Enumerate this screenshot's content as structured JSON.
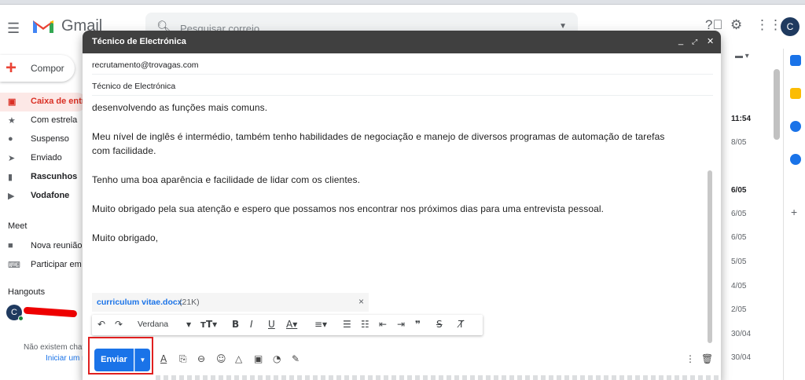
{
  "app": {
    "name": "Gmail"
  },
  "search": {
    "placeholder": "Pesquisar correio"
  },
  "account": {
    "initial": "C"
  },
  "sidebar": {
    "compose_label": "Compor",
    "items": [
      {
        "label": "Caixa de entr",
        "icon": "inbox-icon",
        "active": true
      },
      {
        "label": "Com estrela",
        "icon": "star-icon"
      },
      {
        "label": "Suspenso",
        "icon": "clock-icon"
      },
      {
        "label": "Enviado",
        "icon": "send-icon"
      },
      {
        "label": "Rascunhos",
        "icon": "draft-icon",
        "bold": true
      },
      {
        "label": "Vodafone",
        "icon": "label-icon",
        "bold": true
      }
    ],
    "meet": {
      "header": "Meet",
      "items": [
        {
          "label": "Nova reunião",
          "icon": "video-icon"
        },
        {
          "label": "Participar em",
          "icon": "keyboard-icon"
        }
      ]
    },
    "hangouts": {
      "header": "Hangouts",
      "avatar_initial": "C",
      "empty_text": "Não existem chat",
      "start_link": "Iniciar um r"
    }
  },
  "mail_list": {
    "dates": [
      {
        "text": "11:54",
        "bold": true
      },
      {
        "text": "8/05"
      },
      {
        "text": "6/05",
        "bold": true
      },
      {
        "text": "6/05"
      },
      {
        "text": "6/05"
      },
      {
        "text": "5/05"
      },
      {
        "text": "4/05"
      },
      {
        "text": "2/05"
      },
      {
        "text": "30/04"
      },
      {
        "text": "30/04"
      }
    ]
  },
  "compose": {
    "title": "Técnico de Electrónica",
    "to": "recrutamento@trovagas.com",
    "subject": "Técnico de Electrónica",
    "body": [
      "desenvolvendo as funções mais comuns.",
      "",
      "Meu nível de inglês é intermédio, também tenho habilidades de negociação e manejo de diversos programas de automação de tarefas",
      "com facilidade.",
      "",
      "Tenho uma boa aparência e facilidade de lidar com os clientes.",
      "",
      "Muito obrigado pela sua atenção e espero que possamos nos encontrar nos próximos dias para uma entrevista pessoal.",
      "",
      "Muito obrigado,"
    ],
    "attachment": {
      "name": "curriculum vitae.docx",
      "size": "(21K)"
    },
    "format": {
      "font": "Verdana"
    },
    "send_label": "Enviar"
  },
  "colors": {
    "accent": "#1a73e8",
    "header": "#404040",
    "highlight": "#e02020",
    "active_nav": "#d93025"
  }
}
